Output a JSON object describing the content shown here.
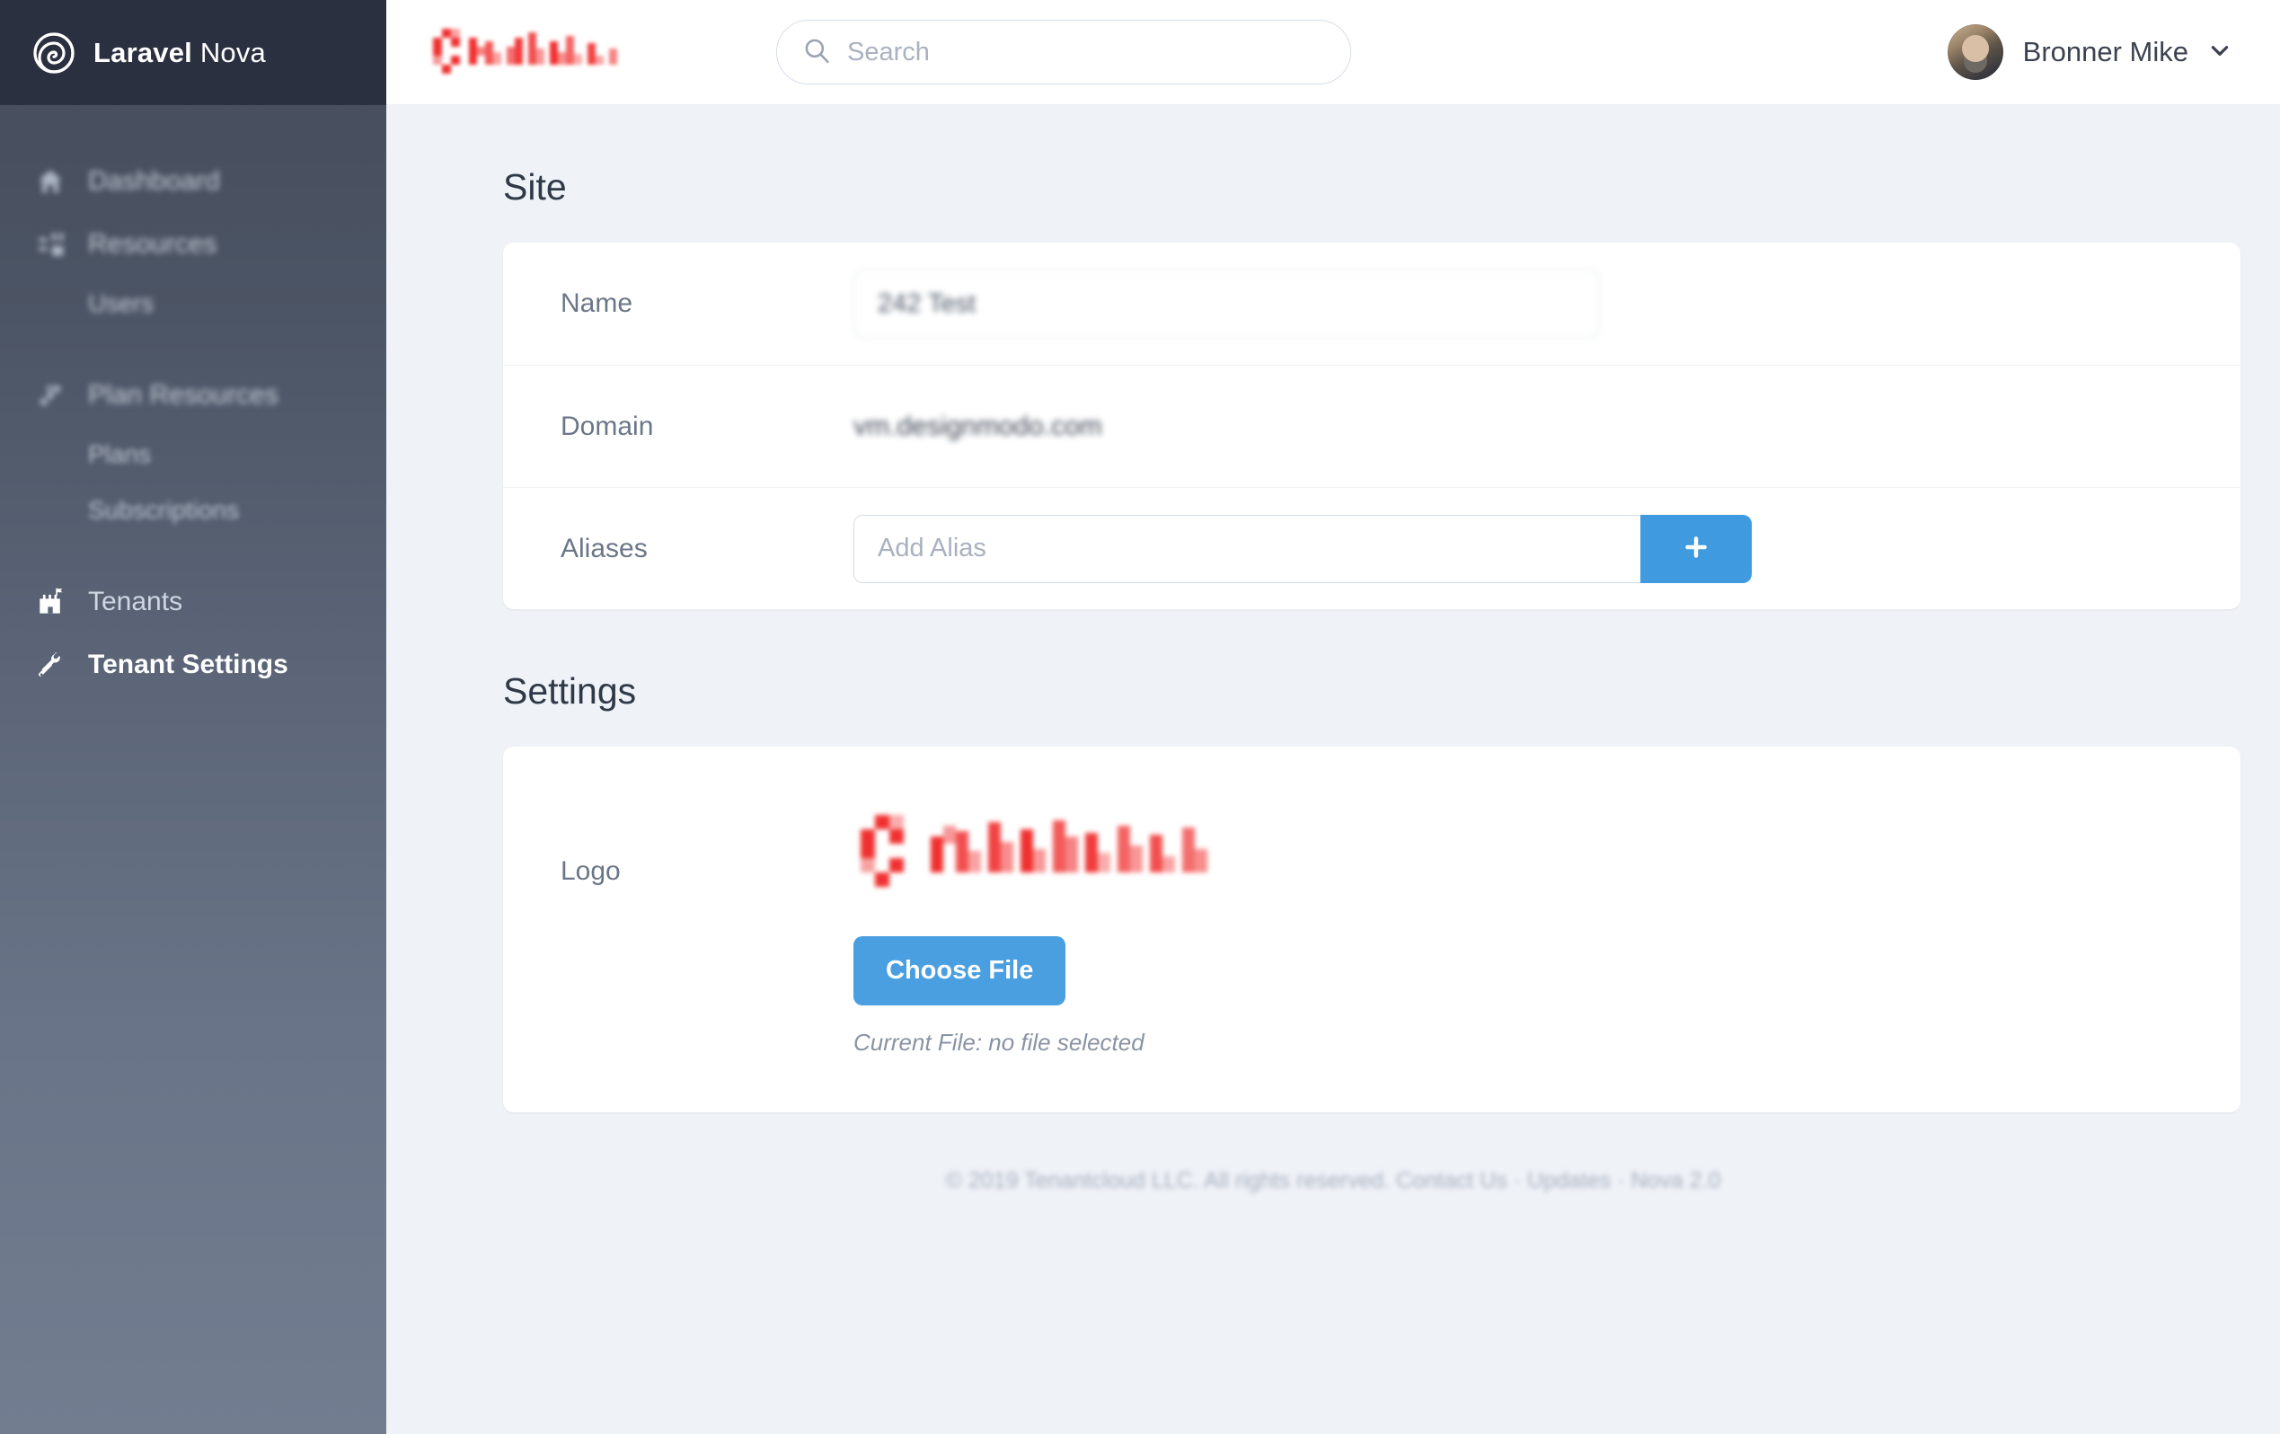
{
  "brand": {
    "name_bold": "Laravel",
    "name_light": "Nova",
    "logo_icon": "nova-spiral-logo"
  },
  "sidebar": {
    "items": [
      {
        "label": "Dashboard",
        "icon": "home-icon",
        "redacted": true,
        "level": "top"
      },
      {
        "label": "Resources",
        "icon": "grid-list-icon",
        "redacted": true,
        "level": "top"
      },
      {
        "label": "Users",
        "icon": "",
        "redacted": true,
        "level": "sub"
      },
      {
        "label": "Plan Resources",
        "icon": "puzzle-icon",
        "redacted": true,
        "level": "top"
      },
      {
        "label": "Plans",
        "icon": "",
        "redacted": true,
        "level": "sub"
      },
      {
        "label": "Subscriptions",
        "icon": "",
        "redacted": true,
        "level": "sub"
      },
      {
        "label": "Tenants",
        "icon": "castle-icon",
        "redacted": false,
        "level": "top"
      },
      {
        "label": "Tenant Settings",
        "icon": "tools-icon",
        "redacted": false,
        "level": "top",
        "active": true
      }
    ]
  },
  "topbar": {
    "tenant_logo_icon": "tenant-logo-redacted",
    "search": {
      "placeholder": "Search",
      "value": "",
      "icon": "search-icon"
    },
    "user": {
      "name": "Bronner Mike",
      "avatar_icon": "user-avatar",
      "chevron_icon": "chevron-down-icon"
    }
  },
  "site": {
    "title": "Site",
    "name": {
      "label": "Name",
      "value": "242 Test",
      "redacted": true
    },
    "domain": {
      "label": "Domain",
      "value": "vm.designmodo.com",
      "redacted": true
    },
    "aliases": {
      "label": "Aliases",
      "placeholder": "Add Alias",
      "value": "",
      "add_icon": "plus-icon"
    }
  },
  "settings": {
    "title": "Settings",
    "logo": {
      "label": "Logo",
      "preview_icon": "tenant-logo-redacted",
      "choose_file_label": "Choose File",
      "current_file_text": "Current File: no file selected"
    }
  },
  "footer": {
    "text": "© 2019 Tenantcloud LLC. All rights reserved. Contact Us · Updates · Nova 2.0",
    "redacted": true
  },
  "colors": {
    "accent_blue": "#3f9ae0",
    "button_blue": "#4a9fe0",
    "sidebar_top": "#2a303f",
    "sidebar_body": "#4a5261",
    "page_bg": "#eff2f7",
    "logo_red": "#f03030"
  }
}
